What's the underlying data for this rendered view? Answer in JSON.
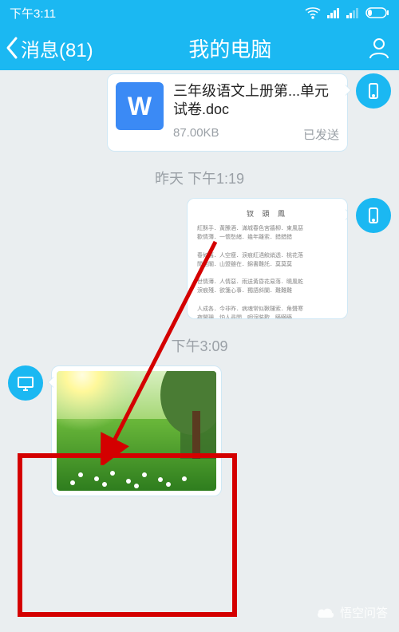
{
  "status": {
    "time": "下午3:11"
  },
  "header": {
    "back_label": "消息(81)",
    "title": "我的电脑"
  },
  "messages": {
    "file": {
      "icon_letter": "W",
      "name": "三年级语文上册第...单元试卷.doc",
      "size": "87.00KB",
      "status": "已发送"
    },
    "ts1": "昨天 下午1:19",
    "doc": {
      "title": "钗 頭 鳳"
    },
    "ts2": "下午3:09"
  },
  "watermark": "悟空问答"
}
